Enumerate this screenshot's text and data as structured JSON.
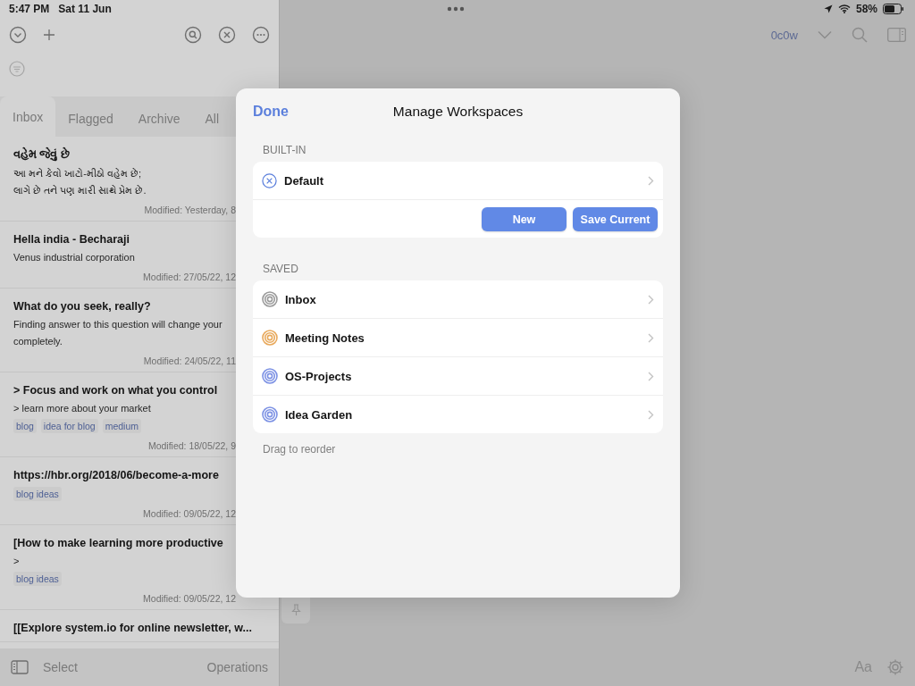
{
  "status_bar": {
    "time": "5:47 PM",
    "date": "Sat 11 Jun",
    "battery": "58%"
  },
  "tabs": [
    {
      "label": "Inbox",
      "selected": true
    },
    {
      "label": "Flagged",
      "selected": false
    },
    {
      "label": "Archive",
      "selected": false
    },
    {
      "label": "All",
      "selected": false
    }
  ],
  "notes": [
    {
      "title": "વહેમ જેવું છે",
      "lines": [
        "આ મને કેવો ખાટો-મીઠો વહેમ છે;",
        "લાગે છે તને પણ મારી સાથે પ્રેમ છે."
      ],
      "modified": "Modified: Yesterday, 8"
    },
    {
      "title": "Hella india  - Becharaji",
      "lines": [
        "Venus industrial corporation"
      ],
      "modified": "Modified: 27/05/22, 12"
    },
    {
      "title": "What do you seek, really?",
      "lines": [
        "Finding answer to this question will change your",
        "completely."
      ],
      "modified": "Modified: 24/05/22, 11"
    },
    {
      "title": "> Focus and work on what you control",
      "lines": [
        "> learn more about your market"
      ],
      "tags": [
        "blog",
        "idea for blog",
        "medium"
      ],
      "modified": "Modified: 18/05/22, 9"
    },
    {
      "title": "https://hbr.org/2018/06/become-a-more",
      "tags": [
        "blog ideas"
      ],
      "modified": "Modified: 09/05/22, 12"
    },
    {
      "title": "[How to make learning more productive",
      "lines": [
        ">"
      ],
      "tags": [
        "blog ideas"
      ],
      "modified": "Modified: 09/05/22, 12"
    },
    {
      "title": "[[Explore system.io for online newsletter, w..."
    }
  ],
  "bottom_bar": {
    "select": "Select",
    "operations": "Operations"
  },
  "editor": {
    "word_count": "0c0w",
    "font_button": "Aa"
  },
  "modal": {
    "done": "Done",
    "title": "Manage Workspaces",
    "sections": [
      {
        "header": "BUILT-IN",
        "items": [
          {
            "name": "Default",
            "kind": "builtin"
          }
        ],
        "buttons": [
          "New",
          "Save Current"
        ]
      },
      {
        "header": "SAVED",
        "items": [
          {
            "name": "Inbox",
            "kind": "saved",
            "color": "#9a9a9a"
          },
          {
            "name": "Meeting Notes",
            "kind": "saved",
            "color": "#e8a95c"
          },
          {
            "name": "OS-Projects",
            "kind": "saved",
            "color": "#7d92e4"
          },
          {
            "name": "Idea Garden",
            "kind": "saved",
            "color": "#7d92e4"
          }
        ]
      }
    ],
    "footer": "Drag to reorder"
  }
}
